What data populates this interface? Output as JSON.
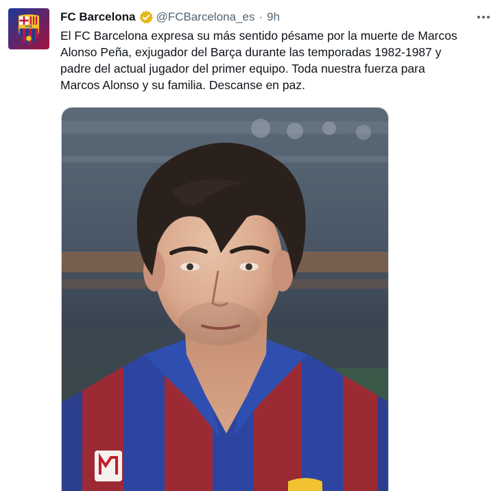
{
  "tweet": {
    "display_name": "FC Barcelona",
    "handle": "@FCBarcelona_es",
    "separator": "·",
    "time": "9h",
    "text_lines": [
      "El FC Barcelona expresa su más sentido pésame por la muerte de Marcos",
      "Alonso Peña, exjugador del Barça durante las temporadas 1982-1987 y",
      "padre del actual jugador del primer equipo. Toda nuestra fuerza para",
      "Marcos Alonso y su familia. Descanse en paz."
    ],
    "avatar_crest_letters": "FCB",
    "verified_icon": "gold-verified-badge-icon",
    "more_icon": "more-horizontal-icon",
    "photo": "portrait-of-player-in-blaugrana-shirt",
    "colors": {
      "avatar_bg": "#1a3a9c",
      "crest_red": "#c4133b",
      "crest_blue": "#1d3c8f",
      "crest_gold": "#f2c230",
      "verified_gold": "#e2b719",
      "text": "#0f1419",
      "secondary": "#536471"
    }
  }
}
